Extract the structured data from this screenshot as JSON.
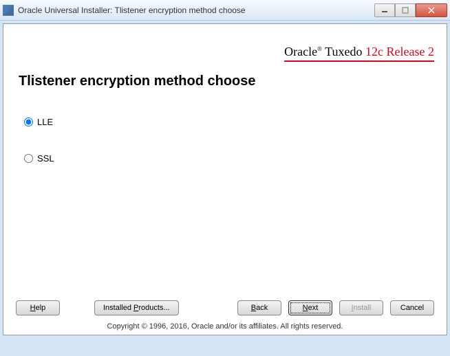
{
  "titlebar": {
    "title": "Oracle Universal Installer: Tlistener encryption method choose"
  },
  "brand": {
    "name": "Oracle",
    "reg": "®",
    "product": "Tuxedo",
    "version": "12c Release 2"
  },
  "heading": "Tlistener encryption method choose",
  "options": {
    "lle": "LLE",
    "ssl": "SSL"
  },
  "buttons": {
    "help_m": "H",
    "help": "elp",
    "installed": "Installed ",
    "installed_m": "P",
    "installed2": "roducts...",
    "back_m": "B",
    "back": "ack",
    "next_m": "N",
    "next": "ext",
    "install_m": "I",
    "install": "nstall",
    "cancel": "Cancel"
  },
  "copyright": "Copyright © 1996, 2016, Oracle and/or its affiliates. All rights reserved."
}
